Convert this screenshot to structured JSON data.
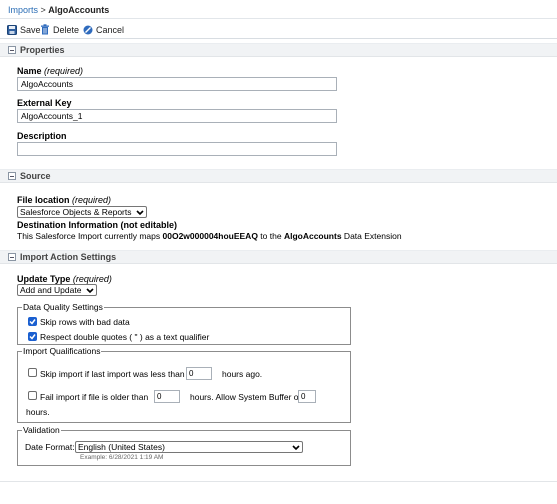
{
  "breadcrumb": {
    "parent": "Imports",
    "separator": " > ",
    "current": "AlgoAccounts"
  },
  "toolbar": {
    "save": "Save",
    "delete": "Delete",
    "cancel": "Cancel"
  },
  "properties": {
    "title": "Properties",
    "name_label": "Name",
    "name_required": "(required)",
    "name_value": "AlgoAccounts",
    "external_key_label": "External Key",
    "external_key_value": "AlgoAccounts_1",
    "description_label": "Description",
    "description_value": ""
  },
  "source": {
    "title": "Source",
    "file_location_label": "File location",
    "file_location_required": "(required)",
    "file_location_value": "Salesforce Objects & Reports",
    "destination_label": "Destination Information (not editable)",
    "dest_text_1": "This Salesforce Import currently maps ",
    "dest_id": "00O2w000004houEEAQ",
    "dest_text_2": " to the ",
    "dest_name": "AlgoAccounts",
    "dest_text_3": " Data Extension"
  },
  "import_action": {
    "title": "Import Action Settings",
    "update_type_label": "Update Type",
    "update_type_required": "(required)",
    "update_type_value": "Add and Update",
    "data_quality": {
      "legend": "Data Quality Settings",
      "skip_bad_label": "Skip rows with bad data",
      "skip_bad_checked": true,
      "respect_quotes_label": "Respect double quotes ( \" ) as a text qualifier",
      "respect_quotes_checked": true
    },
    "qualifications": {
      "legend": "Import Qualifications",
      "skip_label_1": "Skip import if last import was less than",
      "skip_value": "0",
      "skip_label_2": "hours ago.",
      "fail_label_1": "Fail import if file is older than",
      "fail_value": "0",
      "fail_label_2": "hours. Allow System Buffer of",
      "buffer_value": "0",
      "fail_label_3": "hours."
    },
    "validation": {
      "legend": "Validation",
      "date_format_label": "Date Format:",
      "date_format_value": "English (United States)",
      "example": "Example: 6/28/2021 1:19 AM"
    }
  },
  "colors": {
    "link": "#2a6db5",
    "checkbox": "#1a5fd0",
    "section_bg": "#f1f3f5"
  }
}
